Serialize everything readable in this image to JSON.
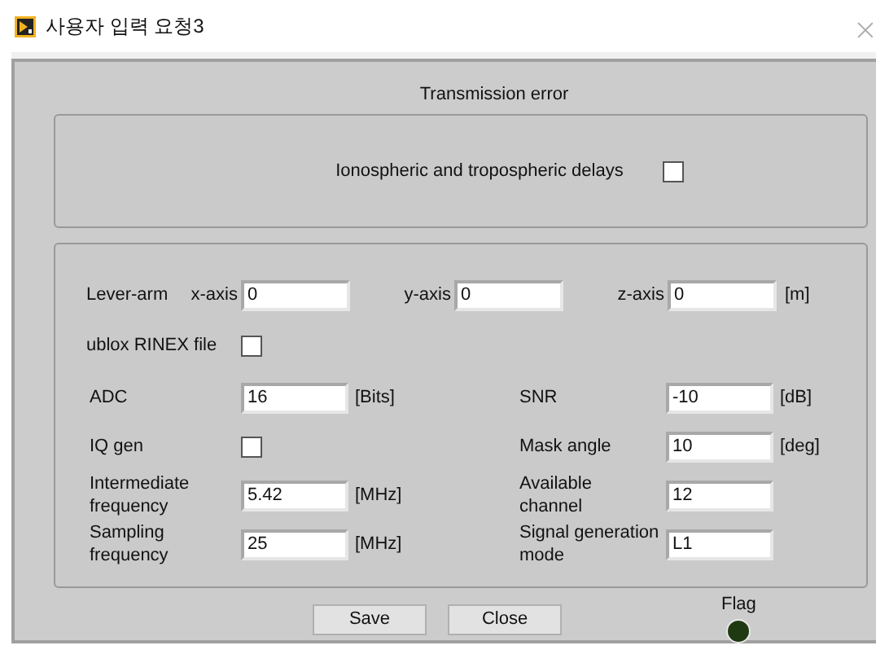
{
  "window": {
    "title": "사용자 입력 요청3"
  },
  "section_title": "Transmission error",
  "delays": {
    "label": "Ionospheric and tropospheric delays",
    "checked": false
  },
  "lever_arm": {
    "label": "Lever-arm",
    "axes": [
      {
        "label": "x-axis",
        "value": "0"
      },
      {
        "label": "y-axis",
        "value": "0"
      },
      {
        "label": "z-axis",
        "value": "0"
      }
    ],
    "unit": "[m]"
  },
  "ublox": {
    "label": "ublox RINEX file",
    "checked": false
  },
  "left_params": [
    {
      "kind": "field",
      "label": "ADC",
      "value": "16",
      "unit": "[Bits]"
    },
    {
      "kind": "checkbox",
      "label": "IQ gen",
      "checked": false
    },
    {
      "kind": "field",
      "label": "Intermediate frequency",
      "value": "5.42",
      "unit": "[MHz]"
    },
    {
      "kind": "field",
      "label": "Sampling frequency",
      "value": "25",
      "unit": "[MHz]"
    }
  ],
  "right_params": [
    {
      "kind": "field",
      "label": "SNR",
      "value": "-10",
      "unit": "[dB]"
    },
    {
      "kind": "field",
      "label": "Mask angle",
      "value": "10",
      "unit": "[deg]"
    },
    {
      "kind": "field",
      "label": "Available channel",
      "value": "12"
    },
    {
      "kind": "field",
      "label": "Signal generation mode",
      "value": "L1"
    }
  ],
  "buttons": [
    "Save",
    "Close"
  ],
  "flag": {
    "label": "Flag",
    "on": false
  }
}
